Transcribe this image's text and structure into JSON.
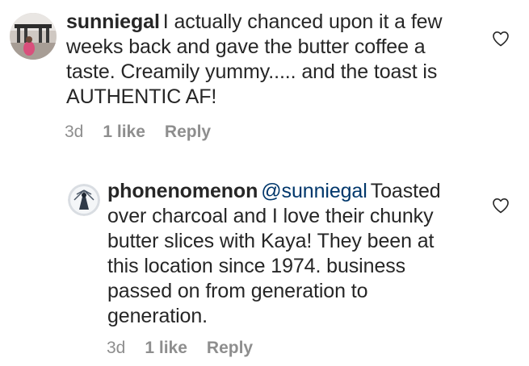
{
  "comments": [
    {
      "username": "sunniegal",
      "text": "I actually chanced upon it a few weeks back and gave the butter coffee a taste. Creamily yummy..... and the toast is AUTHENTIC AF!",
      "time": "3d",
      "likes": "1 like",
      "reply_label": "Reply",
      "like_icon": "heart-outline-icon"
    },
    {
      "username": "phonenomenon",
      "mention": "@sunniegal",
      "text": "Toasted over charcoal and I love their chunky butter slices with Kaya! They been at this location since 1974. business passed on from generation to generation.",
      "time": "3d",
      "likes": "1 like",
      "reply_label": "Reply",
      "like_icon": "heart-outline-icon"
    }
  ],
  "colors": {
    "text": "#262626",
    "meta": "#8e8e8e",
    "mention": "#00376b"
  }
}
